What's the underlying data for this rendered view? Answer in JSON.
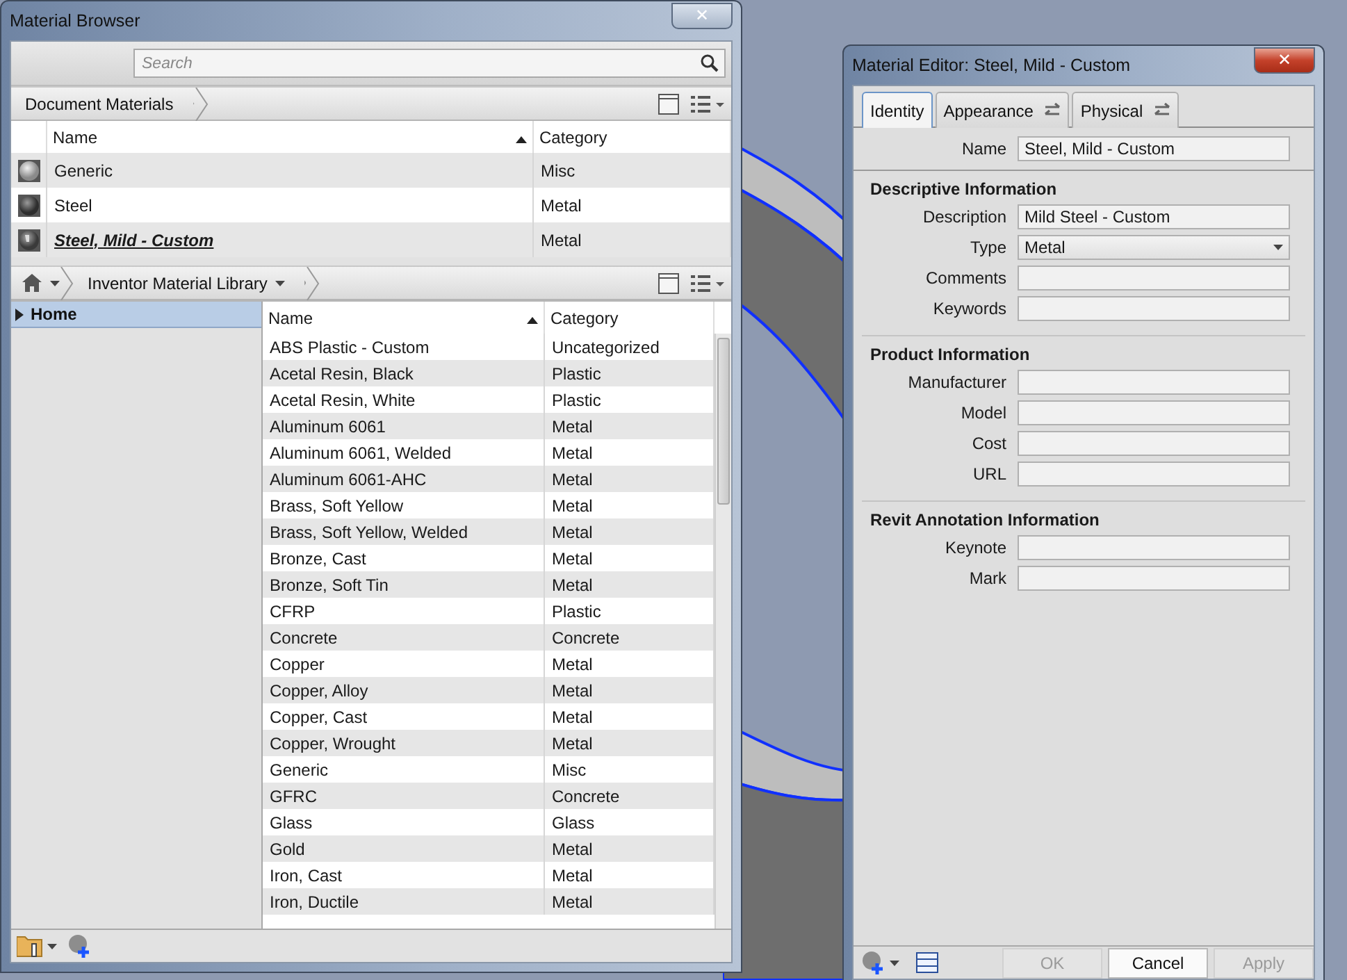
{
  "material_browser": {
    "title": "Material Browser",
    "close": "✕",
    "search": {
      "placeholder": "Search"
    },
    "document_materials": {
      "label": "Document Materials",
      "columns": [
        {
          "label": "Name",
          "sorted": true
        },
        {
          "label": "Category",
          "sorted": false
        }
      ],
      "rows": [
        {
          "name": "Generic",
          "category": "Misc",
          "active": false,
          "kind": "light"
        },
        {
          "name": "Steel",
          "category": "Metal",
          "active": false,
          "kind": "dark"
        },
        {
          "name": "Steel, Mild - Custom",
          "category": "Metal",
          "active": true,
          "kind": "custom"
        }
      ]
    },
    "library": {
      "label": "Inventor Material Library",
      "tree": [
        {
          "label": "Home",
          "selected": true,
          "expanded": false
        }
      ],
      "columns": [
        {
          "label": "Name",
          "sorted": true
        },
        {
          "label": "Category",
          "sorted": false
        }
      ],
      "rows": [
        {
          "name": "ABS Plastic - Custom",
          "category": "Uncategorized"
        },
        {
          "name": "Acetal Resin, Black",
          "category": "Plastic"
        },
        {
          "name": "Acetal Resin, White",
          "category": "Plastic"
        },
        {
          "name": "Aluminum 6061",
          "category": "Metal"
        },
        {
          "name": "Aluminum 6061, Welded",
          "category": "Metal"
        },
        {
          "name": "Aluminum 6061-AHC",
          "category": "Metal"
        },
        {
          "name": "Brass, Soft Yellow",
          "category": "Metal"
        },
        {
          "name": "Brass, Soft Yellow, Welded",
          "category": "Metal"
        },
        {
          "name": "Bronze, Cast",
          "category": "Metal"
        },
        {
          "name": "Bronze, Soft Tin",
          "category": "Metal"
        },
        {
          "name": "CFRP",
          "category": "Plastic"
        },
        {
          "name": "Concrete",
          "category": "Concrete"
        },
        {
          "name": "Copper",
          "category": "Metal"
        },
        {
          "name": "Copper, Alloy",
          "category": "Metal"
        },
        {
          "name": "Copper, Cast",
          "category": "Metal"
        },
        {
          "name": "Copper, Wrought",
          "category": "Metal"
        },
        {
          "name": "Generic",
          "category": "Misc"
        },
        {
          "name": "GFRC",
          "category": "Concrete"
        },
        {
          "name": "Glass",
          "category": "Glass"
        },
        {
          "name": "Gold",
          "category": "Metal"
        },
        {
          "name": "Iron, Cast",
          "category": "Metal"
        },
        {
          "name": "Iron, Ductile",
          "category": "Metal"
        }
      ]
    }
  },
  "material_editor": {
    "title": "Material Editor: Steel, Mild - Custom",
    "close": "✕",
    "tabs": [
      {
        "label": "Identity",
        "selected": true,
        "kind": "plain"
      },
      {
        "label": "Appearance",
        "selected": false,
        "kind": "linked"
      },
      {
        "label": "Physical",
        "selected": false,
        "kind": "linked"
      }
    ],
    "name_field": {
      "label": "Name",
      "value": "Steel, Mild - Custom"
    },
    "sections": [
      {
        "title": "Descriptive Information",
        "fields": [
          {
            "label": "Description",
            "value": "Mild Steel - Custom",
            "kind": "text"
          },
          {
            "label": "Type",
            "value": "Metal",
            "kind": "dropdown"
          },
          {
            "label": "Comments",
            "kind": "text"
          },
          {
            "label": "Keywords",
            "kind": "text"
          }
        ]
      },
      {
        "title": "Product Information",
        "fields": [
          {
            "label": "Manufacturer",
            "kind": "text"
          },
          {
            "label": "Model",
            "kind": "text"
          },
          {
            "label": "Cost",
            "kind": "text"
          },
          {
            "label": "URL",
            "kind": "text"
          }
        ]
      },
      {
        "title": "Revit Annotation Information",
        "fields": [
          {
            "label": "Keynote",
            "kind": "text"
          },
          {
            "label": "Mark",
            "kind": "text"
          }
        ]
      }
    ],
    "buttons": [
      {
        "label": "OK",
        "disabled": true
      },
      {
        "label": "Cancel",
        "disabled": false
      },
      {
        "label": "Apply",
        "disabled": true
      }
    ]
  }
}
